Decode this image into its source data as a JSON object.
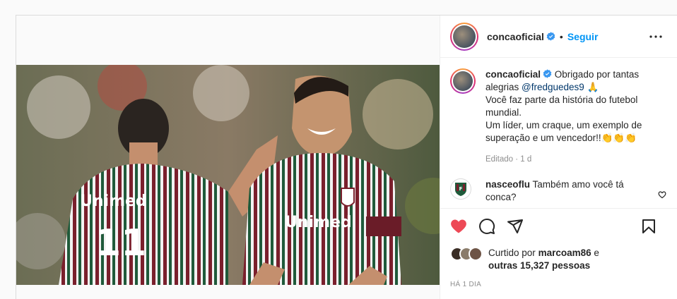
{
  "post": {
    "username": "concaoficial",
    "separator": "•",
    "follow_label": "Seguir",
    "caption": {
      "username": "concaoficial",
      "line1": "Obrigado por tantas alegrias",
      "mention": "@fredguedes9",
      "emoji_pray": "🙏",
      "line2": "Você faz parte da história do futebol mundial.",
      "line3": "Um líder, um craque, um exemplo de superação e um vencedor!!",
      "emoji_clap": "👏👏👏"
    },
    "edited": "Editado · 1 d",
    "comments": [
      {
        "username": "nasceoflu",
        "text": "Também amo você tá conca?"
      }
    ],
    "likes": {
      "prefix": "Curtido por",
      "user": "marcoam86",
      "connector": "e",
      "others": "outras 15,327 pessoas"
    },
    "time_ago": "HÁ 1 DIA",
    "photo": {
      "jersey_text": "Unimed",
      "jersey_number": "11"
    }
  },
  "colors": {
    "like_red": "#ed4956",
    "link_blue": "#0095f6",
    "verified_blue": "#3897f0",
    "jersey_maroon": "#7a1f2c",
    "jersey_green": "#1f5a3a"
  },
  "icons": [
    "verified-badge-icon",
    "more-options-icon",
    "heart-icon",
    "comment-icon",
    "share-icon",
    "bookmark-icon",
    "small-heart-icon"
  ]
}
